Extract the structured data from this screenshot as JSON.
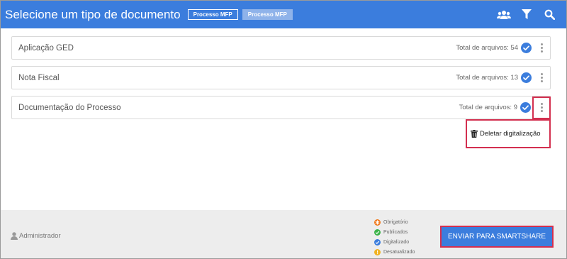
{
  "header": {
    "title": "Selecione um tipo de documento",
    "badges": [
      "Processo MFP",
      "Processo MFP"
    ]
  },
  "documents": [
    {
      "name": "Aplicação GED",
      "total_label": "Total de arquivos: 54"
    },
    {
      "name": "Nota Fiscal",
      "total_label": "Total de arquivos: 13"
    },
    {
      "name": "Documentação do Processo",
      "total_label": "Total de arquivos: 9"
    }
  ],
  "context_menu": {
    "delete_label": "Deletar digitalização"
  },
  "footer": {
    "user": "Administrador",
    "legend": [
      {
        "label": "Obrigatório",
        "color": "#f07a1e"
      },
      {
        "label": "Publicados",
        "color": "#3cb34a"
      },
      {
        "label": "Digitalizado",
        "color": "#3b7ddd"
      },
      {
        "label": "Desatualizado",
        "color": "#f0b323"
      }
    ],
    "send_label": "ENVIAR PARA SMARTSHARE"
  },
  "colors": {
    "primary": "#3b7ddd",
    "highlight": "#d32f4f"
  }
}
